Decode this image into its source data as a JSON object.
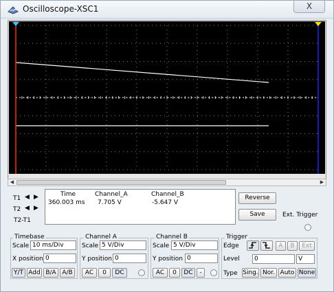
{
  "window": {
    "title": "Oscilloscope-XSC1",
    "close_label": "X"
  },
  "screen": {
    "background": "#000000",
    "grid_color": "#808080",
    "trace_color": "#ffffff",
    "cursor1_color": "#ff2a00",
    "cursor2_color": "#1a22ff"
  },
  "readout": {
    "headers": [
      "Time",
      "Channel_A",
      "Channel_B"
    ],
    "rows": [
      {
        "label": "T1",
        "values": [
          "360.003 ms",
          "7.705 V",
          "-5.647 V"
        ]
      },
      {
        "label": "T2",
        "values": [
          "",
          "",
          ""
        ]
      },
      {
        "label": "T2-T1",
        "values": [
          "",
          "",
          ""
        ]
      }
    ]
  },
  "buttons": {
    "reverse": "Reverse",
    "save": "Save"
  },
  "ext_trigger": "Ext. Trigger",
  "timebase": {
    "title": "Timebase",
    "scale_label": "Scale",
    "scale_value": "10 ms/Div",
    "xpos_label": "X position",
    "xpos_value": "0",
    "modes": [
      "Y/T",
      "Add",
      "B/A",
      "A/B"
    ]
  },
  "channel_a": {
    "title": "Channel A",
    "scale_label": "Scale",
    "scale_value": "5  V/Div",
    "ypos_label": "Y position",
    "ypos_value": "0",
    "coupling": [
      "AC",
      "0",
      "DC"
    ]
  },
  "channel_b": {
    "title": "Channel B",
    "scale_label": "Scale",
    "scale_value": "5  V/Div",
    "ypos_label": "Y position",
    "ypos_value": "0",
    "coupling": [
      "AC",
      "0",
      "DC",
      "-"
    ]
  },
  "trigger": {
    "title": "Trigger",
    "edge_label": "Edge",
    "sources": [
      "A",
      "B",
      "Ext"
    ],
    "level_label": "Level",
    "level_value": "0",
    "level_unit": "V",
    "type_label": "Type",
    "types": [
      "Sing.",
      "Nor.",
      "Auto",
      "None"
    ]
  }
}
